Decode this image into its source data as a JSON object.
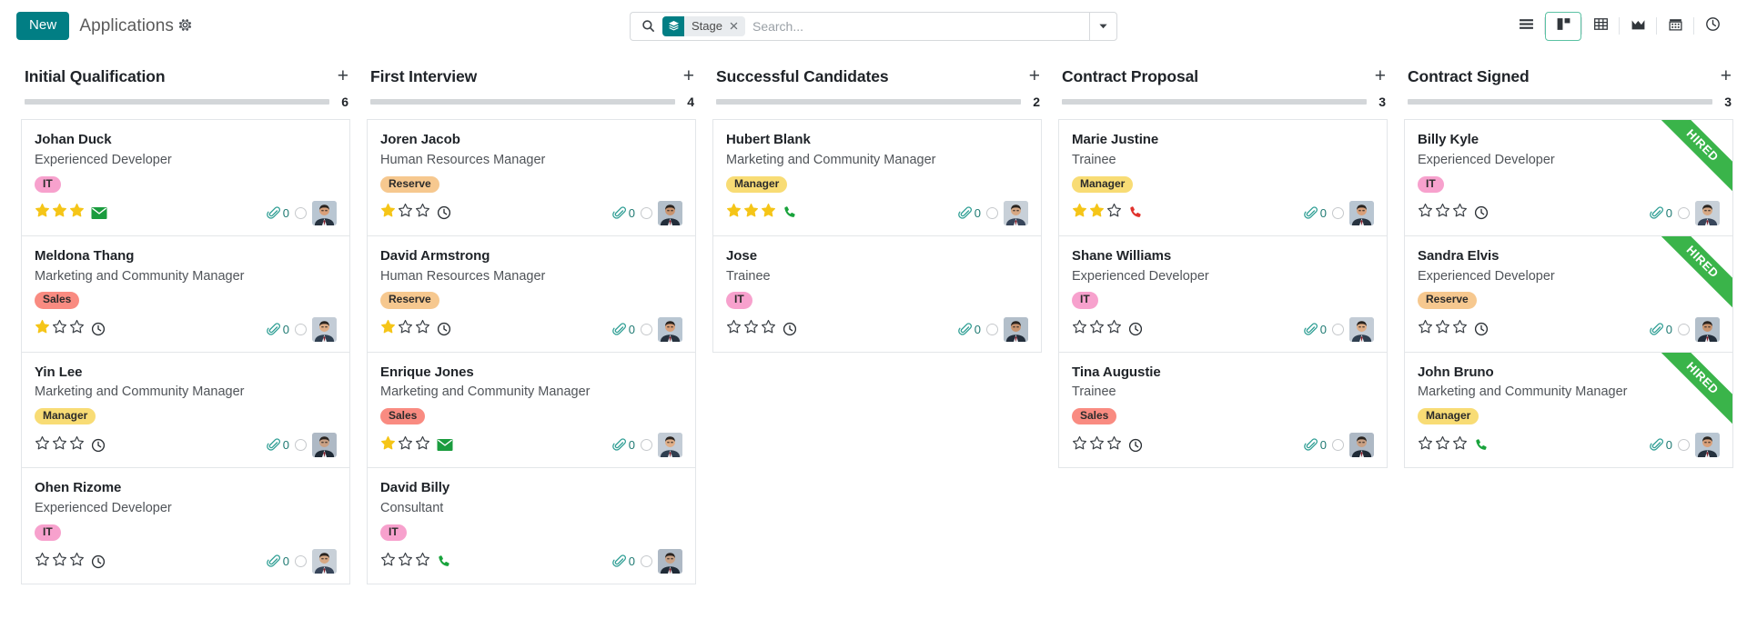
{
  "control_panel": {
    "new_label": "New",
    "breadcrumb": "Applications",
    "gear_icon": "gear-icon",
    "search": {
      "search_icon": "search-icon",
      "facet_icon": "layers-icon",
      "facet_label": "Stage",
      "facet_remove_icon": "close-icon",
      "placeholder": "Search...",
      "caret_icon": "chevron-down-icon"
    },
    "views": [
      {
        "name": "list-view",
        "icon": "list-icon",
        "active": false
      },
      {
        "name": "kanban-view",
        "icon": "kanban-icon",
        "active": true
      },
      {
        "name": "pivot-view",
        "icon": "grid-icon",
        "active": false
      },
      {
        "name": "graph-view",
        "icon": "chart-area-icon",
        "active": false
      },
      {
        "name": "calendar-view",
        "icon": "calendar-icon",
        "active": false
      },
      {
        "name": "activity-view",
        "icon": "clock-icon",
        "active": false
      }
    ],
    "accent_color": "#017e84",
    "active_view_border": "#5cc2a4"
  },
  "board": {
    "add_icon": "plus-icon",
    "attachment_icon": "paperclip-icon",
    "kanban_state_icon": "circle-icon",
    "columns": [
      {
        "title": "Initial Qualification",
        "count": "6",
        "cards": [
          {
            "name": "Johan Duck",
            "role": "Experienced Developer",
            "tag": "IT",
            "tag_class": "it",
            "stars": 3,
            "activity": "email",
            "attachments": "0",
            "ribbon": ""
          },
          {
            "name": "Meldona Thang",
            "role": "Marketing and Community Manager",
            "tag": "Sales",
            "tag_class": "sales",
            "stars": 1,
            "activity": "clock",
            "attachments": "0",
            "ribbon": ""
          },
          {
            "name": "Yin Lee",
            "role": "Marketing and Community Manager",
            "tag": "Manager",
            "tag_class": "manager",
            "stars": 0,
            "activity": "clock",
            "attachments": "0",
            "ribbon": ""
          },
          {
            "name": "Ohen Rizome",
            "role": "Experienced Developer",
            "tag": "IT",
            "tag_class": "it",
            "stars": 0,
            "activity": "clock",
            "attachments": "0",
            "ribbon": ""
          }
        ]
      },
      {
        "title": "First Interview",
        "count": "4",
        "cards": [
          {
            "name": "Joren Jacob",
            "role": "Human Resources Manager",
            "tag": "Reserve",
            "tag_class": "reserve",
            "stars": 1,
            "activity": "clock",
            "attachments": "0",
            "ribbon": ""
          },
          {
            "name": "David Armstrong",
            "role": "Human Resources Manager",
            "tag": "Reserve",
            "tag_class": "reserve",
            "stars": 1,
            "activity": "clock",
            "attachments": "0",
            "ribbon": ""
          },
          {
            "name": "Enrique Jones",
            "role": "Marketing and Community Manager",
            "tag": "Sales",
            "tag_class": "sales",
            "stars": 1,
            "activity": "email",
            "attachments": "0",
            "ribbon": ""
          },
          {
            "name": "David Billy",
            "role": "Consultant",
            "tag": "IT",
            "tag_class": "it",
            "stars": 0,
            "activity": "phone",
            "attachments": "0",
            "ribbon": ""
          }
        ]
      },
      {
        "title": "Successful Candidates",
        "count": "2",
        "cards": [
          {
            "name": "Hubert Blank",
            "role": "Marketing and Community Manager",
            "tag": "Manager",
            "tag_class": "manager",
            "stars": 3,
            "activity": "phone",
            "attachments": "0",
            "ribbon": ""
          },
          {
            "name": "Jose",
            "role": "Trainee",
            "tag": "IT",
            "tag_class": "it",
            "stars": 0,
            "activity": "clock",
            "attachments": "0",
            "ribbon": ""
          }
        ]
      },
      {
        "title": "Contract Proposal",
        "count": "3",
        "cards": [
          {
            "name": "Marie Justine",
            "role": "Trainee",
            "tag": "Manager",
            "tag_class": "manager",
            "stars": 2,
            "activity": "phone-late",
            "attachments": "0",
            "ribbon": ""
          },
          {
            "name": "Shane Williams",
            "role": "Experienced Developer",
            "tag": "IT",
            "tag_class": "it",
            "stars": 0,
            "activity": "clock",
            "attachments": "0",
            "ribbon": ""
          },
          {
            "name": "Tina Augustie",
            "role": "Trainee",
            "tag": "Sales",
            "tag_class": "sales",
            "stars": 0,
            "activity": "clock",
            "attachments": "0",
            "ribbon": ""
          }
        ]
      },
      {
        "title": "Contract Signed",
        "count": "3",
        "cards": [
          {
            "name": "Billy Kyle",
            "role": "Experienced Developer",
            "tag": "IT",
            "tag_class": "it",
            "stars": 0,
            "activity": "clock",
            "attachments": "0",
            "ribbon": "HIRED"
          },
          {
            "name": "Sandra Elvis",
            "role": "Experienced Developer",
            "tag": "Reserve",
            "tag_class": "reserve",
            "stars": 0,
            "activity": "clock",
            "attachments": "0",
            "ribbon": "HIRED"
          },
          {
            "name": "John Bruno",
            "role": "Marketing and Community Manager",
            "tag": "Manager",
            "tag_class": "manager",
            "stars": 0,
            "activity": "phone",
            "attachments": "0",
            "ribbon": "HIRED"
          }
        ]
      }
    ]
  },
  "colors": {
    "tag_it": "#f7a1cd",
    "tag_sales": "#f98b81",
    "tag_manager": "#f8dc75",
    "tag_reserve": "#f6c88f",
    "star_filled": "#f5c518",
    "ribbon_green": "#3ab44a",
    "phone_green": "#19a33c",
    "phone_red": "#e0322c",
    "email_green": "#1a9c3e"
  }
}
